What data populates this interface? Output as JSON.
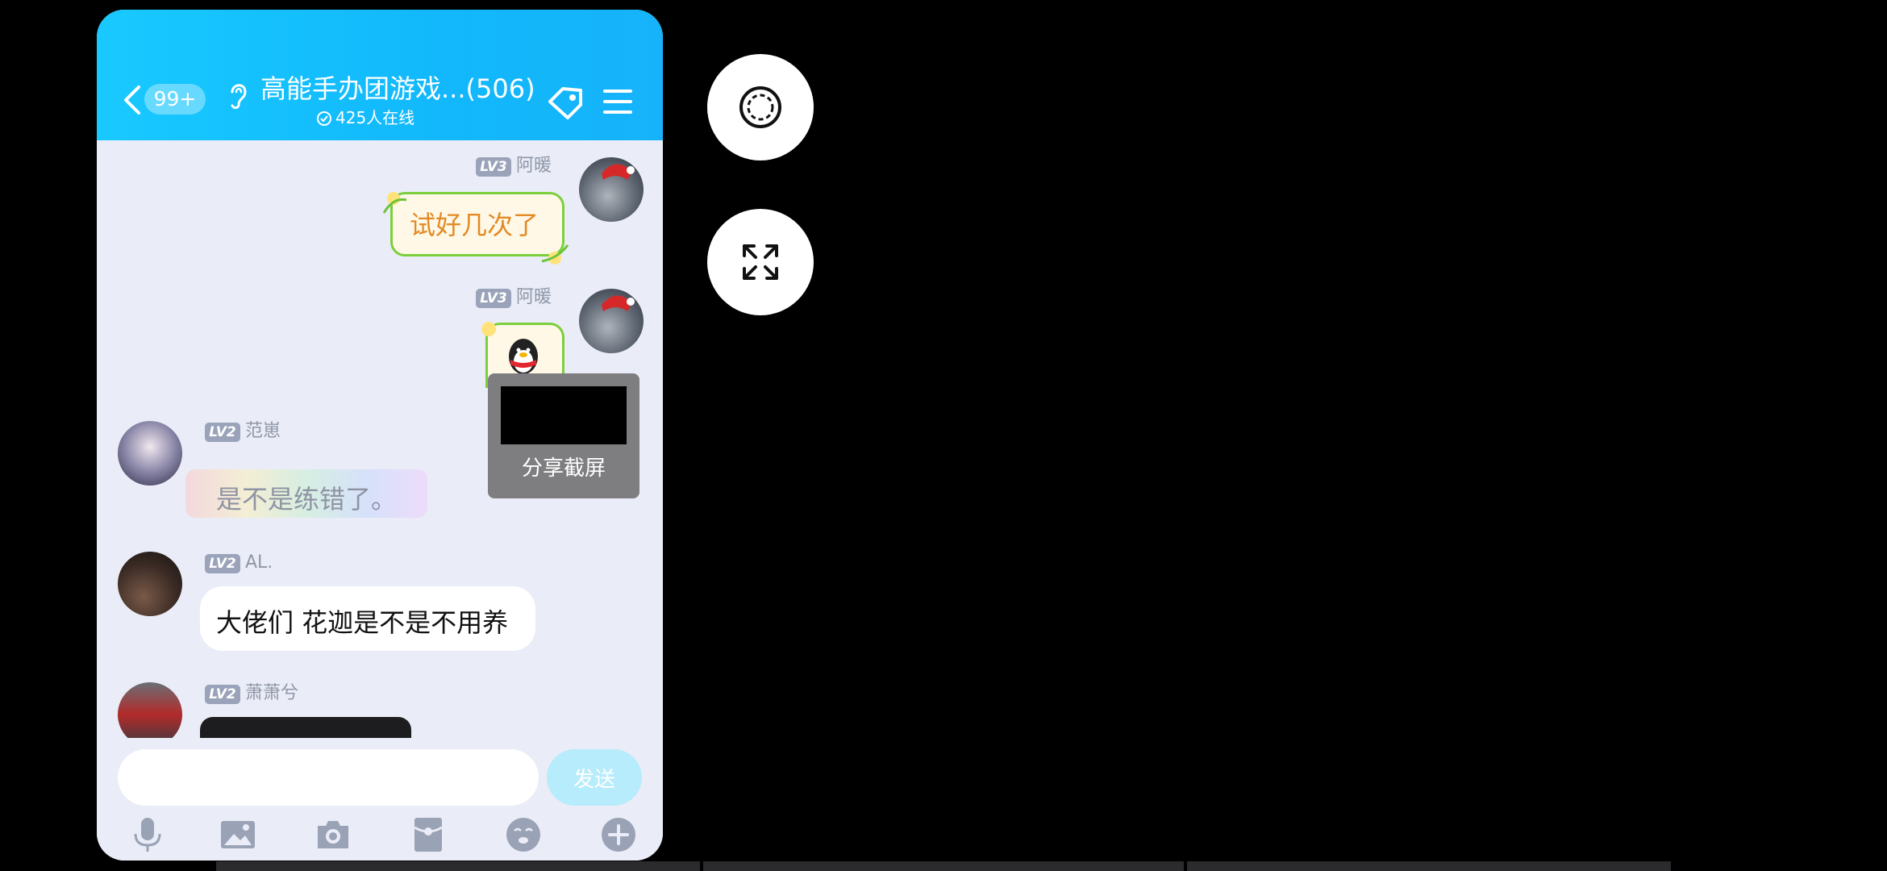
{
  "header": {
    "unread_badge": "99+",
    "group_title": "高能手办团游戏...(506)",
    "online_count": "425人在线"
  },
  "messages": [
    {
      "level": "LV3",
      "sender": "阿暖",
      "text": "试好几次了"
    },
    {
      "level": "LV3",
      "sender": "阿暖",
      "text": ""
    },
    {
      "level": "LV2",
      "sender": "范崽",
      "text": "是不是练错了。"
    },
    {
      "level": "LV2",
      "sender": "AL.",
      "text": "大佬们 花迦是不是不用养"
    },
    {
      "level": "LV2",
      "sender": "萧萧兮",
      "text": ""
    }
  ],
  "share_popup": {
    "label": "分享截屏"
  },
  "composer": {
    "placeholder": "",
    "send_label": "发送"
  },
  "toolbar_icons": [
    "microphone-icon",
    "image-icon",
    "camera-icon",
    "red-packet-icon",
    "emoji-icon",
    "plus-icon"
  ],
  "floating_controls": [
    "screenshot-icon",
    "fullscreen-icon"
  ],
  "colors": {
    "header": "#12b8fb",
    "chat_bg": "#eaedf7",
    "send_btn": "#b6ecfb",
    "bubble_border": "#7ccf3c",
    "bubble_text": "#e28a25"
  }
}
